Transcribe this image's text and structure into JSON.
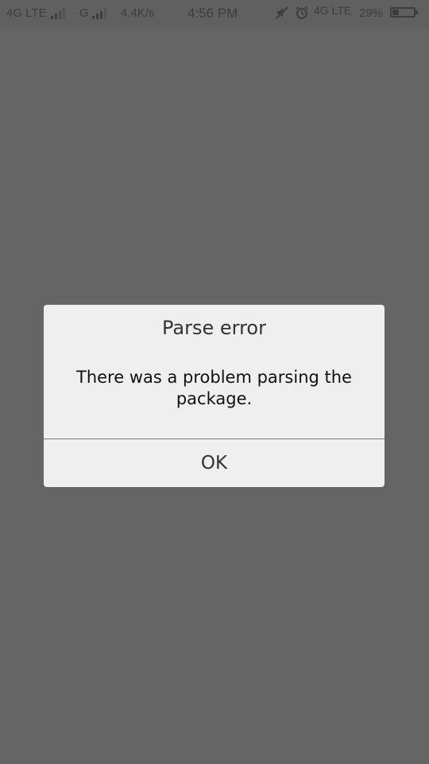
{
  "status_bar": {
    "network_1": "4G LTE",
    "network_2": "G",
    "speed": "4.4K/s",
    "time": "4:56 PM",
    "network_3": "4G LTE",
    "battery": "29%",
    "battery_level": 0.29,
    "mute_icon": "mute-icon",
    "alarm_icon": "alarm-icon"
  },
  "dialog": {
    "title": "Parse error",
    "message": "There was a problem parsing the package.",
    "ok_label": "OK"
  },
  "colors": {
    "overlay": "#656565",
    "dialog_bg": "#efefef",
    "divider": "#7a7a7a"
  }
}
